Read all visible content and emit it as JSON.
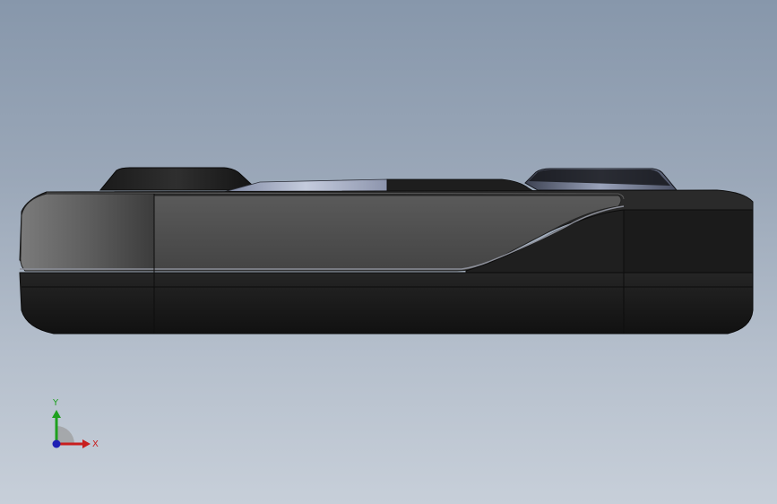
{
  "viewport": {
    "background_top": "#8797ab",
    "background_bottom": "#c7cfd9"
  },
  "model": {
    "body_color": "#1c1c1c",
    "highlight_color": "#4f4f4f",
    "edge_color": "#0a0a0a",
    "glass_color": "#b9c2d6"
  },
  "triad": {
    "x_label": "X",
    "y_label": "Y",
    "x_color": "#c81e1e",
    "y_color": "#1ea01e",
    "z_color": "#1e1eb4"
  }
}
